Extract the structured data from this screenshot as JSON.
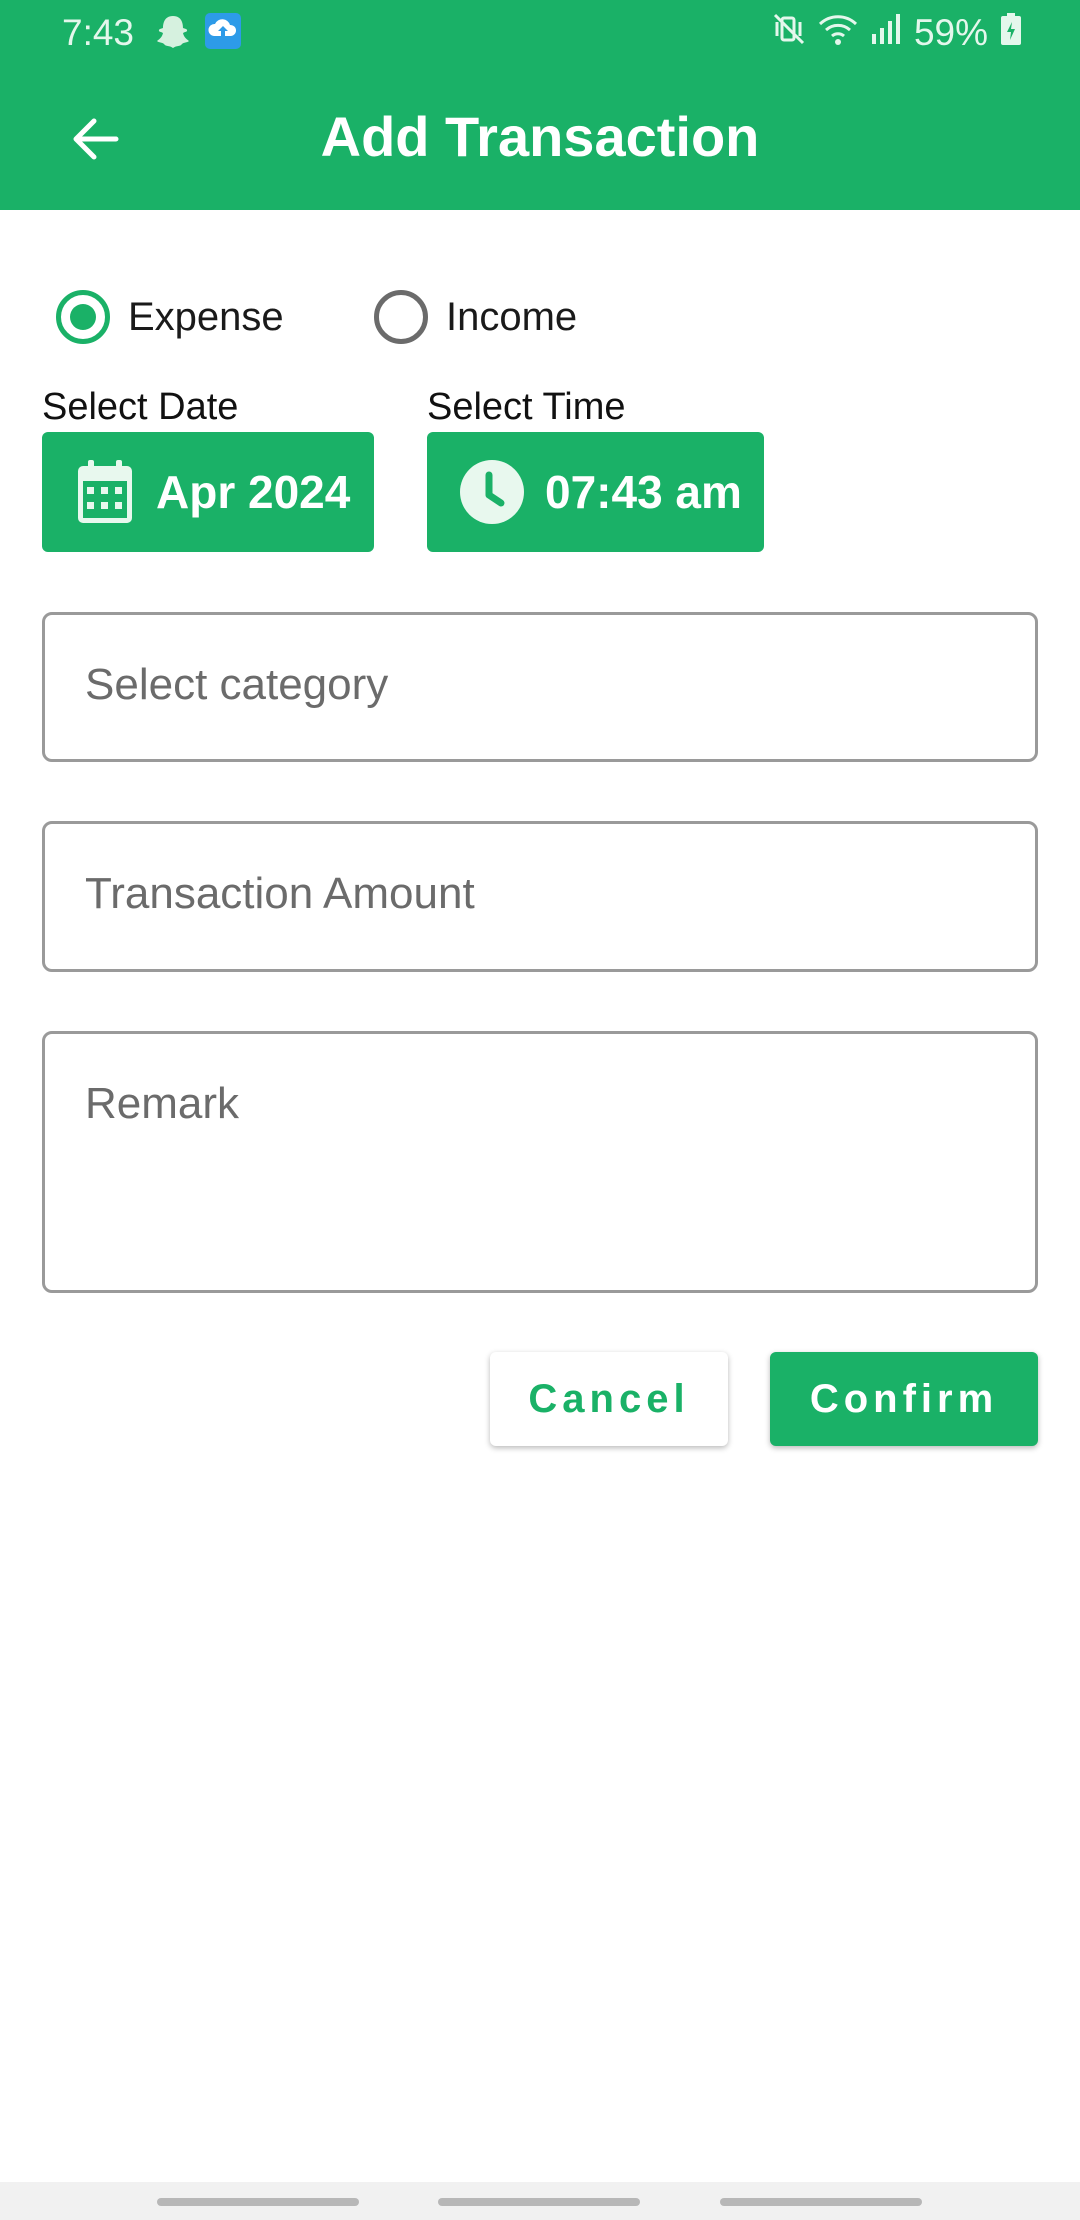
{
  "status_bar": {
    "time": "7:43",
    "battery": "59%",
    "icons": [
      "snapchat-ghost-icon",
      "cloud-upload-icon",
      "vibrate-mute-icon",
      "wifi-icon",
      "signal-icon",
      "battery-icon"
    ]
  },
  "app_bar": {
    "title": "Add Transaction",
    "back_icon": "arrow-back-icon"
  },
  "transaction_type": {
    "options": [
      {
        "label": "Expense",
        "selected": true
      },
      {
        "label": "Income",
        "selected": false
      }
    ]
  },
  "date_picker": {
    "label": "Select Date",
    "value": "Apr 2024",
    "icon": "calendar-icon"
  },
  "time_picker": {
    "label": "Select Time",
    "value": "07:43 am",
    "icon": "clock-icon"
  },
  "form": {
    "category_placeholder": "Select category",
    "amount_placeholder": "Transaction Amount",
    "remark_placeholder": "Remark"
  },
  "actions": {
    "cancel_label": "Cancel",
    "confirm_label": "Confirm"
  },
  "colors": {
    "primary": "#1ab167",
    "field_border": "#9a9a9a",
    "placeholder": "#6b6b6b"
  }
}
